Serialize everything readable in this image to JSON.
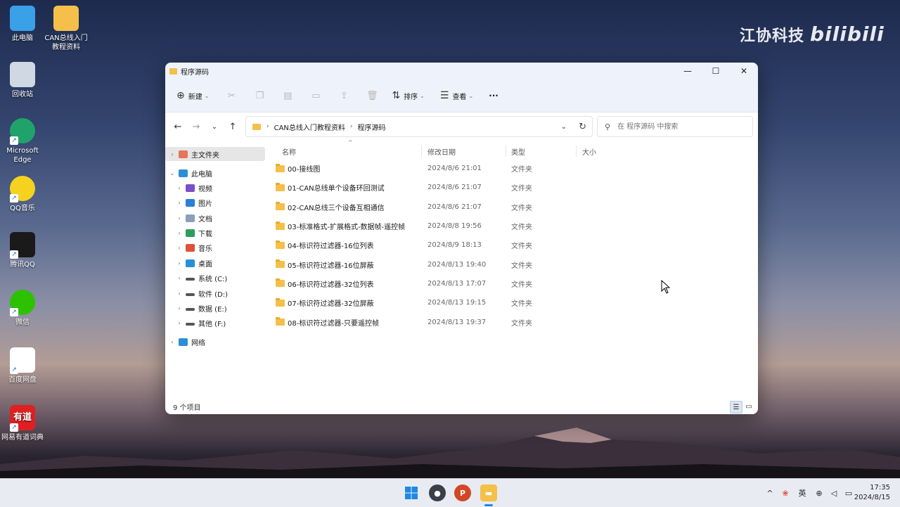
{
  "desktop": {
    "icons": [
      {
        "label": "此电脑",
        "icon": "computer-icon"
      },
      {
        "label": "CAN总线入门教程资料",
        "icon": "folder-icon"
      },
      {
        "label": "回收站",
        "icon": "recycle-bin-icon"
      },
      {
        "label": "Microsoft Edge",
        "icon": "edge-icon"
      },
      {
        "label": "QQ音乐",
        "icon": "qq-music-icon"
      },
      {
        "label": "腾讯QQ",
        "icon": "qq-icon"
      },
      {
        "label": "微信",
        "icon": "wechat-icon"
      },
      {
        "label": "百度网盘",
        "icon": "baidu-netdisk-icon"
      },
      {
        "label": "网易有道词典",
        "icon": "youdao-icon",
        "badge": "有道"
      }
    ],
    "watermark_text": "江协科技",
    "watermark_logo": "bilibili"
  },
  "window": {
    "title": "程序源码",
    "controls": {
      "minimize": "—",
      "maximize": "☐",
      "close": "✕"
    },
    "toolbar": {
      "new_label": "新建",
      "sort_label": "排序",
      "view_label": "查看",
      "more_label": "···"
    },
    "address": {
      "segments": [
        "CAN总线入门教程资料",
        "程序源码"
      ],
      "separator": "›"
    },
    "search": {
      "placeholder": "在 程序源码 中搜索"
    },
    "sidebar": [
      {
        "label": "主文件夹",
        "icon": "home-icon",
        "color": "#e8745a",
        "selected": true,
        "indent": 0,
        "chevron": "›"
      },
      {
        "label": "此电脑",
        "icon": "computer-icon",
        "color": "#2b8fd6",
        "indent": 0,
        "chevron": "⌄"
      },
      {
        "label": "视频",
        "icon": "video-icon",
        "color": "#7a4fc9",
        "indent": 1,
        "chevron": "›"
      },
      {
        "label": "图片",
        "icon": "pictures-icon",
        "color": "#2b7fd6",
        "indent": 1,
        "chevron": "›"
      },
      {
        "label": "文档",
        "icon": "documents-icon",
        "color": "#8aa0b8",
        "indent": 1,
        "chevron": "›"
      },
      {
        "label": "下载",
        "icon": "download-icon",
        "color": "#2e9d5a",
        "indent": 1,
        "chevron": "›"
      },
      {
        "label": "音乐",
        "icon": "music-icon",
        "color": "#e0503a",
        "indent": 1,
        "chevron": "›"
      },
      {
        "label": "桌面",
        "icon": "desktop-icon",
        "color": "#2b8fd6",
        "indent": 1,
        "chevron": "›"
      },
      {
        "label": "系统 (C:)",
        "icon": "drive-c-icon",
        "color": "#555555",
        "indent": 1,
        "chevron": "›"
      },
      {
        "label": "软件 (D:)",
        "icon": "drive-d-icon",
        "color": "#555555",
        "indent": 1,
        "chevron": "›"
      },
      {
        "label": "数据 (E:)",
        "icon": "drive-e-icon",
        "color": "#555555",
        "indent": 1,
        "chevron": "›"
      },
      {
        "label": "其他 (F:)",
        "icon": "drive-f-icon",
        "color": "#555555",
        "indent": 1,
        "chevron": "›"
      },
      {
        "label": "网络",
        "icon": "network-icon",
        "color": "#2b8fd6",
        "indent": 0,
        "chevron": "›"
      }
    ],
    "columns": {
      "name": "名称",
      "date": "修改日期",
      "type": "类型",
      "size": "大小"
    },
    "files": [
      {
        "name": "00-接线图",
        "date": "2024/8/6 21:01",
        "type": "文件夹"
      },
      {
        "name": "01-CAN总线单个设备环回测试",
        "date": "2024/8/6 21:07",
        "type": "文件夹"
      },
      {
        "name": "02-CAN总线三个设备互相通信",
        "date": "2024/8/6 21:07",
        "type": "文件夹"
      },
      {
        "name": "03-标准格式-扩展格式-数据帧-遥控帧",
        "date": "2024/8/8 19:56",
        "type": "文件夹"
      },
      {
        "name": "04-标识符过滤器-16位列表",
        "date": "2024/8/9 18:13",
        "type": "文件夹"
      },
      {
        "name": "05-标识符过滤器-16位屏蔽",
        "date": "2024/8/13 19:40",
        "type": "文件夹"
      },
      {
        "name": "06-标识符过滤器-32位列表",
        "date": "2024/8/13 17:07",
        "type": "文件夹"
      },
      {
        "name": "07-标识符过滤器-32位屏蔽",
        "date": "2024/8/13 19:15",
        "type": "文件夹"
      },
      {
        "name": "08-标识符过滤器-只要遥控帧",
        "date": "2024/8/13 19:37",
        "type": "文件夹"
      }
    ],
    "status": {
      "count": "9 个项目"
    }
  },
  "taskbar": {
    "apps": [
      "start-icon",
      "camera-app-icon",
      "powerpoint-icon",
      "file-explorer-icon"
    ],
    "tray": {
      "chevron": "^",
      "ime": "英"
    },
    "clock": {
      "time": "17:35",
      "date": "2024/8/15"
    }
  }
}
